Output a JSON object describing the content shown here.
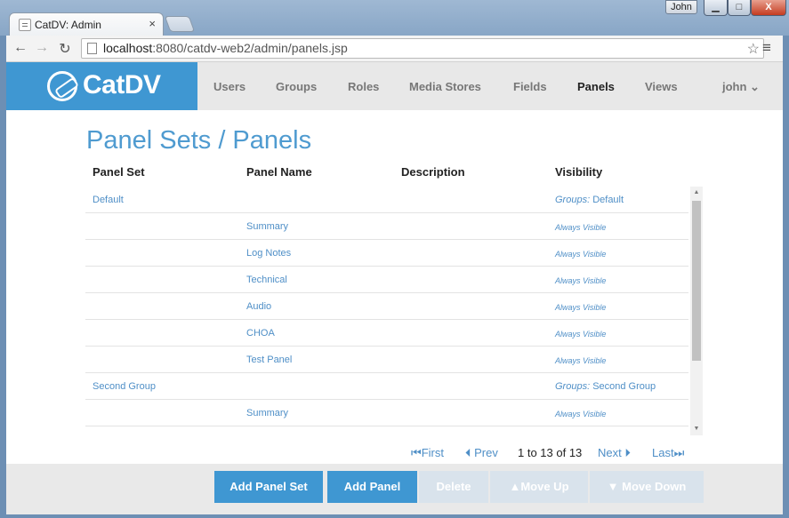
{
  "browser": {
    "tab_title": "CatDV: Admin",
    "tab_close": "×",
    "user_badge": "John",
    "url_host": "localhost",
    "url_rest": ":8080/catdv-web2/admin/panels.jsp",
    "window_controls": {
      "minimize": "▁",
      "maximize": "□",
      "close": "X"
    }
  },
  "app": {
    "logo_text": "CatDV",
    "brand_color": "#3f97d2",
    "nav": [
      {
        "label": "Users"
      },
      {
        "label": "Groups"
      },
      {
        "label": "Roles"
      },
      {
        "label": "Media Stores"
      },
      {
        "label": "Fields"
      },
      {
        "label": "Panels",
        "active": true
      },
      {
        "label": "Views"
      }
    ],
    "user_menu": "john ⌄"
  },
  "page": {
    "title": "Panel Sets / Panels",
    "columns": {
      "panel_set": "Panel Set",
      "panel_name": "Panel Name",
      "description": "Description",
      "visibility": "Visibility"
    },
    "rows": [
      {
        "panel_set": "Default",
        "panel_name": "",
        "description": "",
        "vis_prefix": "Groups:",
        "vis_value": " Default"
      },
      {
        "panel_set": "",
        "panel_name": "Summary",
        "description": "",
        "visibility": "Always Visible"
      },
      {
        "panel_set": "",
        "panel_name": "Log Notes",
        "description": "",
        "visibility": "Always Visible"
      },
      {
        "panel_set": "",
        "panel_name": "Technical",
        "description": "",
        "visibility": "Always Visible"
      },
      {
        "panel_set": "",
        "panel_name": "Audio",
        "description": "",
        "visibility": "Always Visible"
      },
      {
        "panel_set": "",
        "panel_name": "CHOA",
        "description": "",
        "visibility": "Always Visible"
      },
      {
        "panel_set": "",
        "panel_name": "Test Panel",
        "description": "",
        "visibility": "Always Visible"
      },
      {
        "panel_set": "Second Group",
        "panel_name": "",
        "description": "",
        "vis_prefix": "Groups:",
        "vis_value": " Second Group"
      },
      {
        "panel_set": "",
        "panel_name": "Summary",
        "description": "",
        "visibility": "Always Visible"
      }
    ],
    "pager": {
      "first": "⏮First",
      "prev": "⏴ Prev",
      "count": "1 to 13 of 13",
      "next": "Next ⏵",
      "last": "Last⏭"
    },
    "buttons": {
      "add_panel_set": "Add Panel Set",
      "add_panel": "Add Panel",
      "delete": "Delete",
      "move_up": "▲Move Up",
      "move_down": "▼ Move Down"
    }
  }
}
